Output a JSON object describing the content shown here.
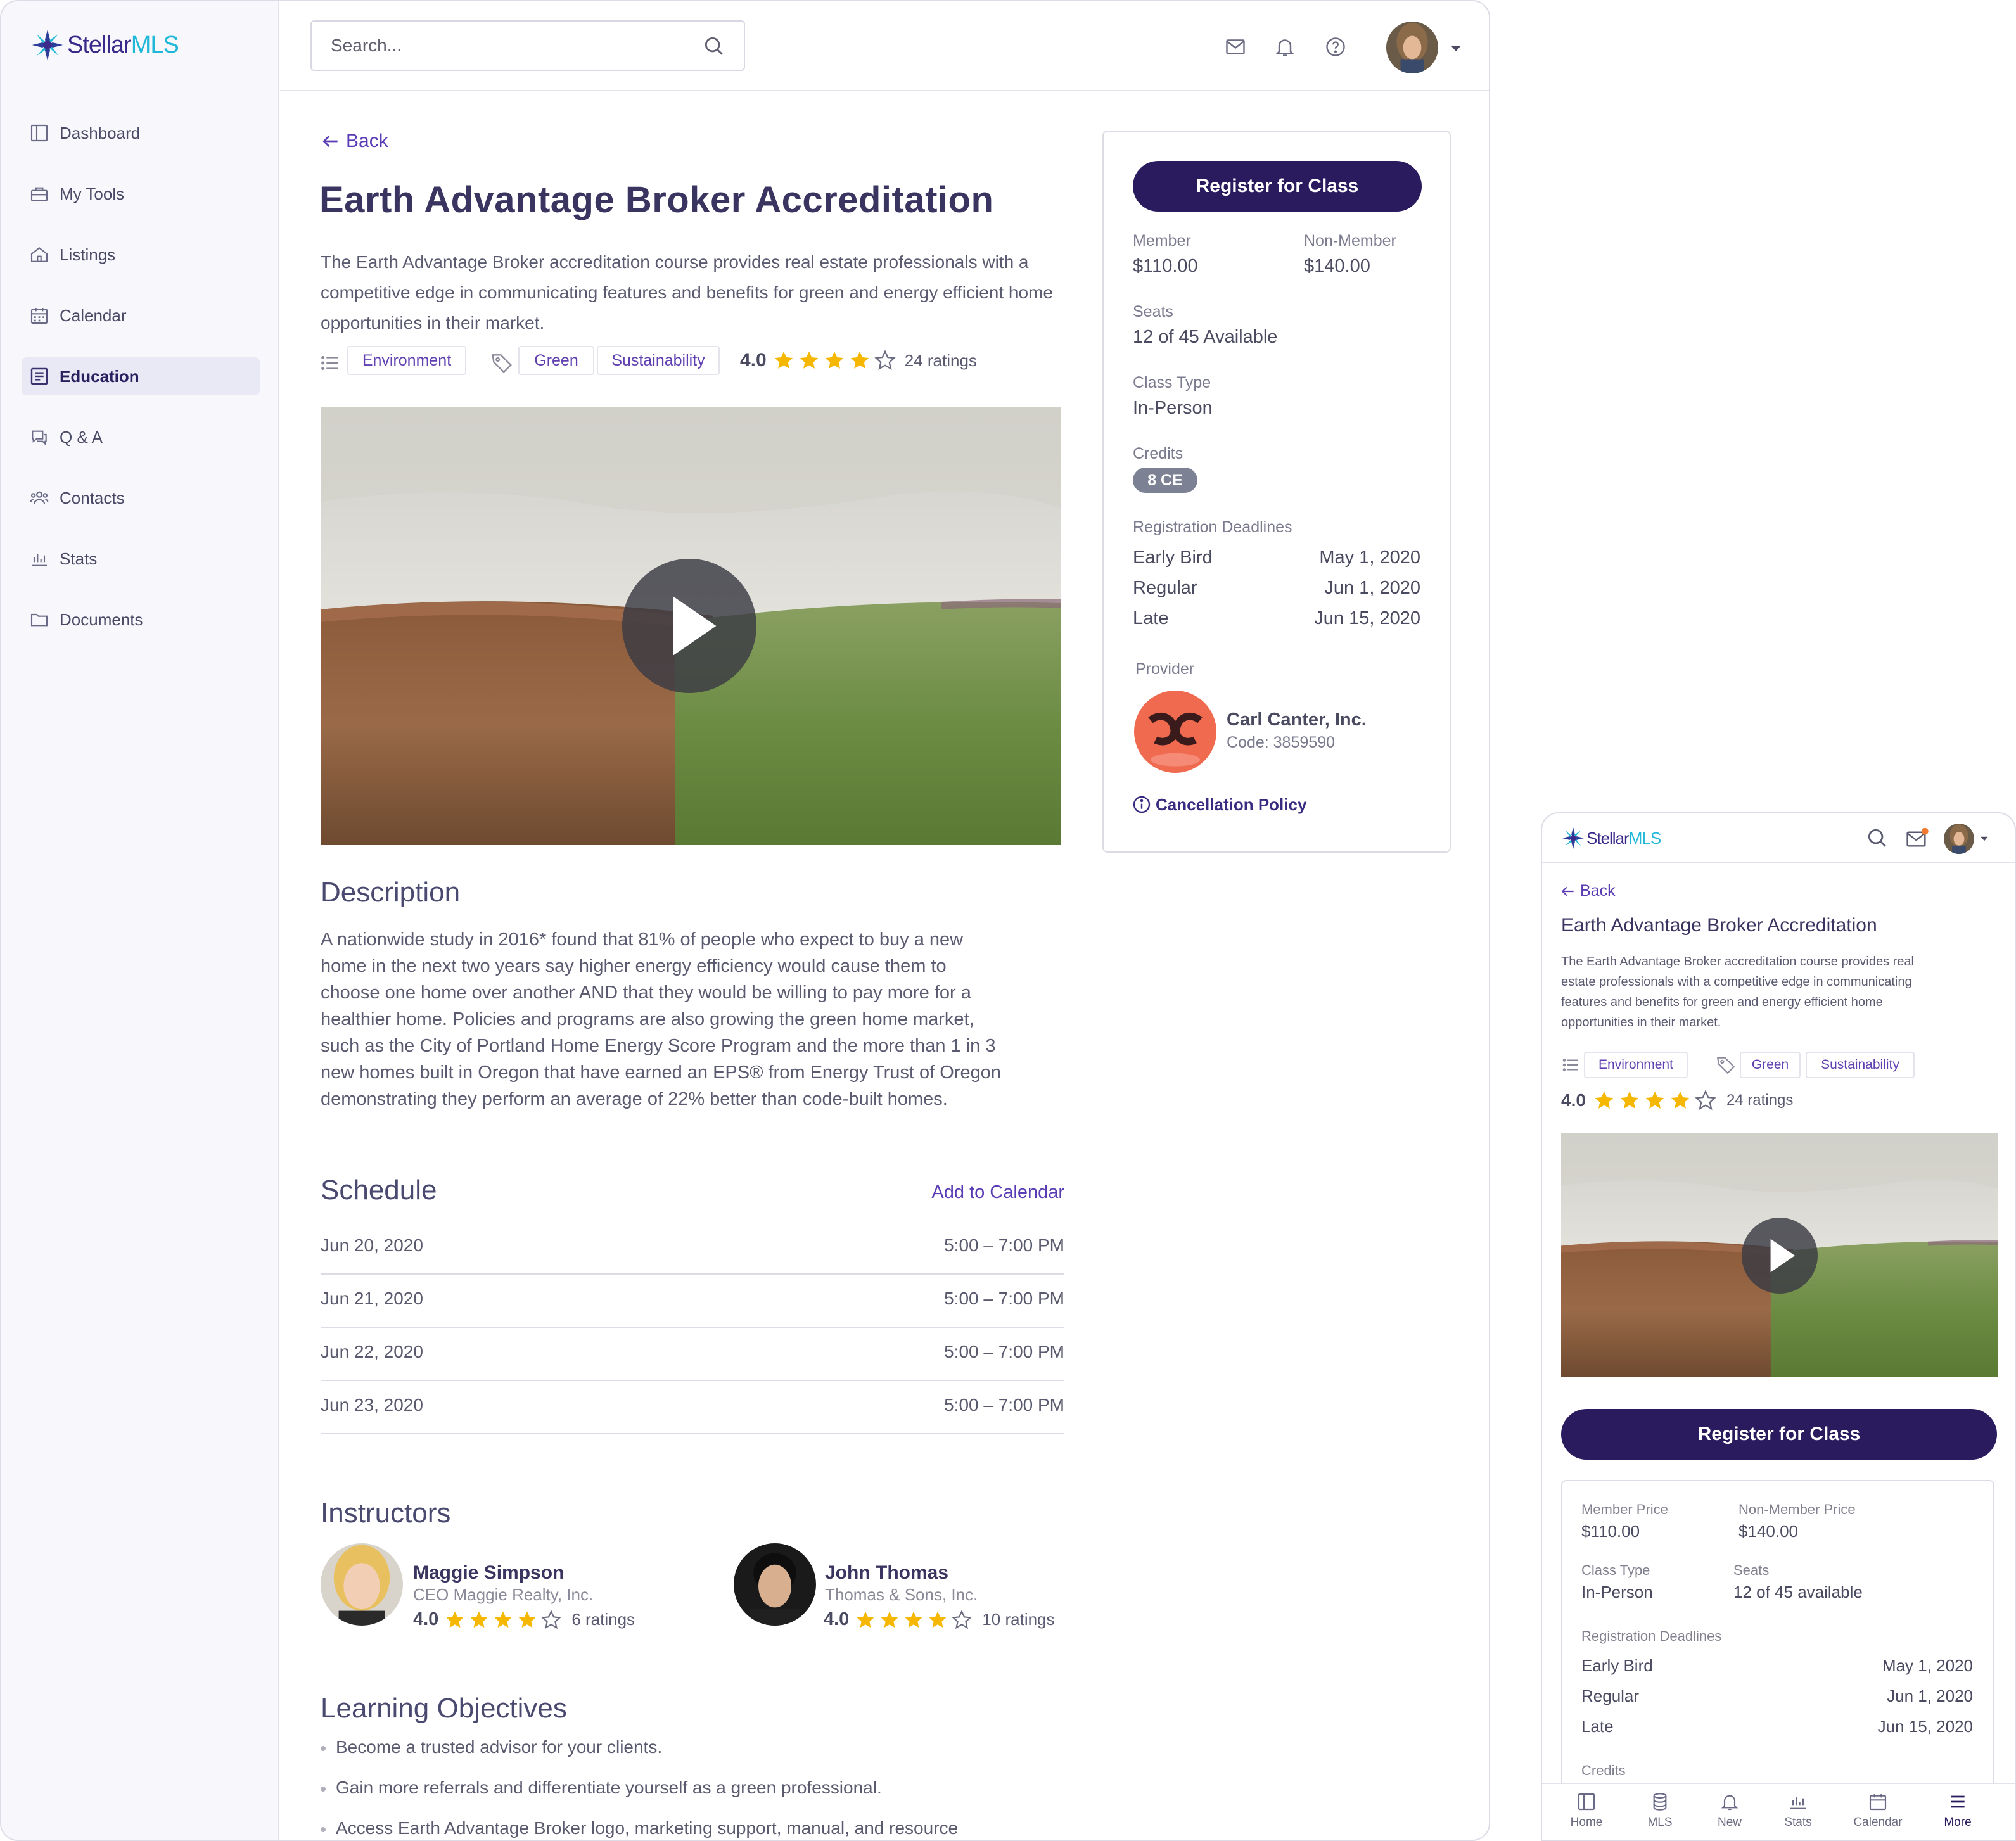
{
  "brand": {
    "part1": "Stellar",
    "part2": "MLS"
  },
  "colors": {
    "primary": "#2a1b5e",
    "accent_link": "#5a3cb4",
    "star": "#f5b700",
    "badge": "#7c8294",
    "provider_logo": "#f06a50"
  },
  "sidebar": {
    "items": [
      {
        "label": "Dashboard",
        "icon": "dashboard-icon"
      },
      {
        "label": "My Tools",
        "icon": "toolbox-icon"
      },
      {
        "label": "Listings",
        "icon": "home-icon"
      },
      {
        "label": "Calendar",
        "icon": "calendar-icon"
      },
      {
        "label": "Education",
        "icon": "book-icon",
        "active": true
      },
      {
        "label": "Q & A",
        "icon": "chat-icon"
      },
      {
        "label": "Contacts",
        "icon": "users-icon"
      },
      {
        "label": "Stats",
        "icon": "chart-icon"
      },
      {
        "label": "Documents",
        "icon": "folder-icon"
      }
    ]
  },
  "topbar": {
    "search_placeholder": "Search..."
  },
  "course": {
    "back": "Back",
    "title": "Earth Advantage Broker Accreditation",
    "summary": "The Earth Advantage Broker accreditation course provides real estate professionals with a competitive edge in communicating features and benefits for green and energy efficient home opportunities in their market.",
    "category": "Environment",
    "tags": [
      "Green",
      "Sustainability"
    ],
    "rating": "4.0",
    "rating_value": 4,
    "ratings_count": "24 ratings"
  },
  "description": {
    "heading": "Description",
    "lines": [
      "A nationwide study in 2016* found that 81% of people who expect to buy a new",
      "home in the next two years say higher energy efficiency would cause them to",
      "choose one home over another AND that they would be willing to pay more for a",
      "healthier home. Policies and programs are also growing the green home market,",
      "such as the City of Portland Home Energy Score Program and the more than 1 in 3",
      "new homes built in Oregon that have earned an EPS® from Energy Trust of Oregon",
      "demonstrating they perform an average of 22% better than code-built homes."
    ]
  },
  "schedule": {
    "heading": "Schedule",
    "add_to_calendar": "Add to Calendar",
    "rows": [
      {
        "date": "Jun 20, 2020",
        "time": "5:00 – 7:00 PM"
      },
      {
        "date": "Jun 21, 2020",
        "time": "5:00 – 7:00 PM"
      },
      {
        "date": "Jun 22, 2020",
        "time": "5:00 – 7:00 PM"
      },
      {
        "date": "Jun 23, 2020",
        "time": "5:00 – 7:00 PM"
      }
    ]
  },
  "instructors": {
    "heading": "Instructors",
    "people": [
      {
        "name": "Maggie Simpson",
        "org": "CEO Maggie Realty, Inc.",
        "rating": "4.0",
        "rating_value": 4,
        "count": "6 ratings"
      },
      {
        "name": "John Thomas",
        "org": "Thomas & Sons, Inc.",
        "rating": "4.0",
        "rating_value": 4,
        "count": "10 ratings"
      }
    ]
  },
  "objectives": {
    "heading": "Learning Objectives",
    "items": [
      "Become a trusted advisor for your clients.",
      "Gain more referrals and differentiate yourself as a green professional.",
      "Access Earth Advantage Broker logo, marketing support, manual, and resource"
    ]
  },
  "card": {
    "register": "Register for Class",
    "member_label": "Member",
    "member_price": "$110.00",
    "nonmember_label": "Non-Member",
    "nonmember_price": "$140.00",
    "seats_label": "Seats",
    "seats": "12 of 45 Available",
    "class_type_label": "Class Type",
    "class_type": "In-Person",
    "credits_label": "Credits",
    "credits": "8 CE",
    "deadlines_label": "Registration Deadlines",
    "deadlines": [
      {
        "name": "Early Bird",
        "date": "May 1, 2020"
      },
      {
        "name": "Regular",
        "date": "Jun 1, 2020"
      },
      {
        "name": "Late",
        "date": "Jun 15, 2020"
      }
    ],
    "provider_label": "Provider",
    "provider_name": "Carl Canter, Inc.",
    "provider_code": "Code: 3859590",
    "cancellation": "Cancellation Policy"
  },
  "mobile": {
    "back": "Back",
    "title": "Earth Advantage Broker Accreditation",
    "summary_lines": [
      "The Earth Advantage Broker accreditation course provides real",
      "estate professionals with a competitive edge in communicating",
      "features and benefits for green and energy efficient home",
      "opportunities in their market."
    ],
    "category": "Environment",
    "tags": [
      "Green",
      "Sustainability"
    ],
    "rating": "4.0",
    "ratings_count": "24 ratings",
    "register": "Register for Class",
    "member_label": "Member Price",
    "member_price": "$110.00",
    "nonmember_label": "Non-Member Price",
    "nonmember_price": "$140.00",
    "class_type_label": "Class Type",
    "class_type": "In-Person",
    "seats_label": "Seats",
    "seats": "12 of 45 available",
    "deadlines_label": "Registration Deadlines",
    "deadlines": [
      {
        "name": "Early Bird",
        "date": "May 1, 2020"
      },
      {
        "name": "Regular",
        "date": "Jun 1, 2020"
      },
      {
        "name": "Late",
        "date": "Jun 15, 2020"
      }
    ],
    "credits_label": "Credits",
    "tabs": [
      {
        "label": "Home",
        "icon": "dashboard-icon"
      },
      {
        "label": "MLS",
        "icon": "database-icon"
      },
      {
        "label": "New",
        "icon": "bell-icon"
      },
      {
        "label": "Stats",
        "icon": "chart-icon"
      },
      {
        "label": "Calendar",
        "icon": "calendar-icon"
      },
      {
        "label": "More",
        "icon": "menu-icon",
        "active": true
      }
    ]
  }
}
